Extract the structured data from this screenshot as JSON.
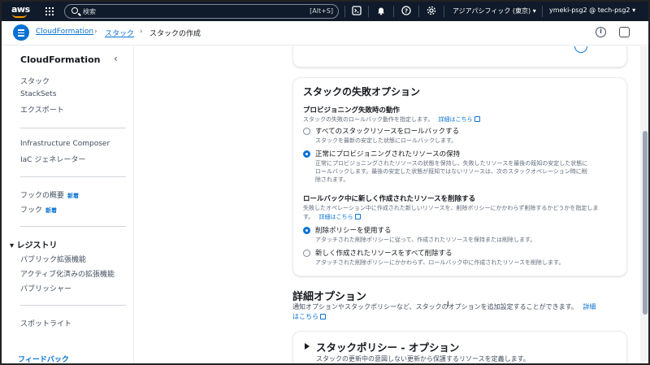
{
  "topnav": {
    "logo": "aws",
    "search_placeholder": "検索",
    "search_shortcut": "[Alt+S]",
    "region": "アジアパシフィック (東京)",
    "account": "ymeki-psg2 @ tech-psg2"
  },
  "breadcrumb": {
    "items": [
      "CloudFormation",
      "スタック",
      "スタックの作成"
    ]
  },
  "sidebar": {
    "title": "CloudFormation",
    "items_group1": [
      "スタック",
      "StackSets",
      "エクスポート"
    ],
    "items_group2": [
      "Infrastructure Composer",
      "IaC ジェネレーター"
    ],
    "items_group3": [
      {
        "label": "フックの概要",
        "badge": "新着"
      },
      {
        "label": "フック",
        "badge": "新着"
      }
    ],
    "registry": {
      "title": "レジストリ",
      "items": [
        "パブリック拡張機能",
        "アクティブ化済みの拡張機能",
        "パブリッシャー"
      ]
    },
    "spotlight": "スポットライト",
    "feedback": "フィードバック"
  },
  "failure_options": {
    "title": "スタックの失敗オプション",
    "provisioning": {
      "heading": "プロビジョニング失敗時の動作",
      "description": "スタックの失敗のロールバック動作を指定します。",
      "info_link": "詳細はこちら",
      "options": [
        {
          "label": "すべてのスタックリソースをロールバックする",
          "description": "スタックを最新の安定した状態にロールバックします。",
          "selected": false
        },
        {
          "label": "正常にプロビジョニングされたリソースの保持",
          "description_lines": [
            "正常にプロビジョニングされたリソースの状態を保持し、失敗したリソースを最後の既知の安定した状態に",
            "ロールバックします。最後の安定した状態が既知ではないリソースは、次のスタックオペレーション時に削",
            "除されます。"
          ],
          "selected": true
        }
      ]
    },
    "delete_new": {
      "heading": "ロールバック中に新しく作成されたリソースを削除する",
      "description": "失敗したオペレーション中に作成された新しいリソースを、削除ポリシーにかかわらず削除するかどうかを指定しま",
      "description_tail": "す。",
      "info_link": "詳細はこちら",
      "options": [
        {
          "label": "削除ポリシーを使用する",
          "description": "アタッチされた削除ポリシーに従って、作成されたリソースを保持または削除します。",
          "selected": true
        },
        {
          "label": "新しく作成されたリソースをすべて削除する",
          "description": "アタッチされた削除ポリシーにかかわらず、ロールバック中に作成されたリソースを削除します。",
          "selected": false
        }
      ]
    }
  },
  "advanced": {
    "title": "詳細オプション",
    "description": "通知オプションやスタックポリシーなど、スタックのオプションを追加設定することができます。",
    "info_link_part1": "詳細",
    "info_link_part2": "はこちら",
    "stack_policy": {
      "title": "スタックポリシー - オプション",
      "description": "スタックの更新中の意図しない更新から保護するリソースを定義します。"
    }
  },
  "colors": {
    "nav_bg": "#0f1b2a",
    "accent": "#0972d3",
    "text": "#16191f",
    "muted": "#5f6b7a"
  }
}
